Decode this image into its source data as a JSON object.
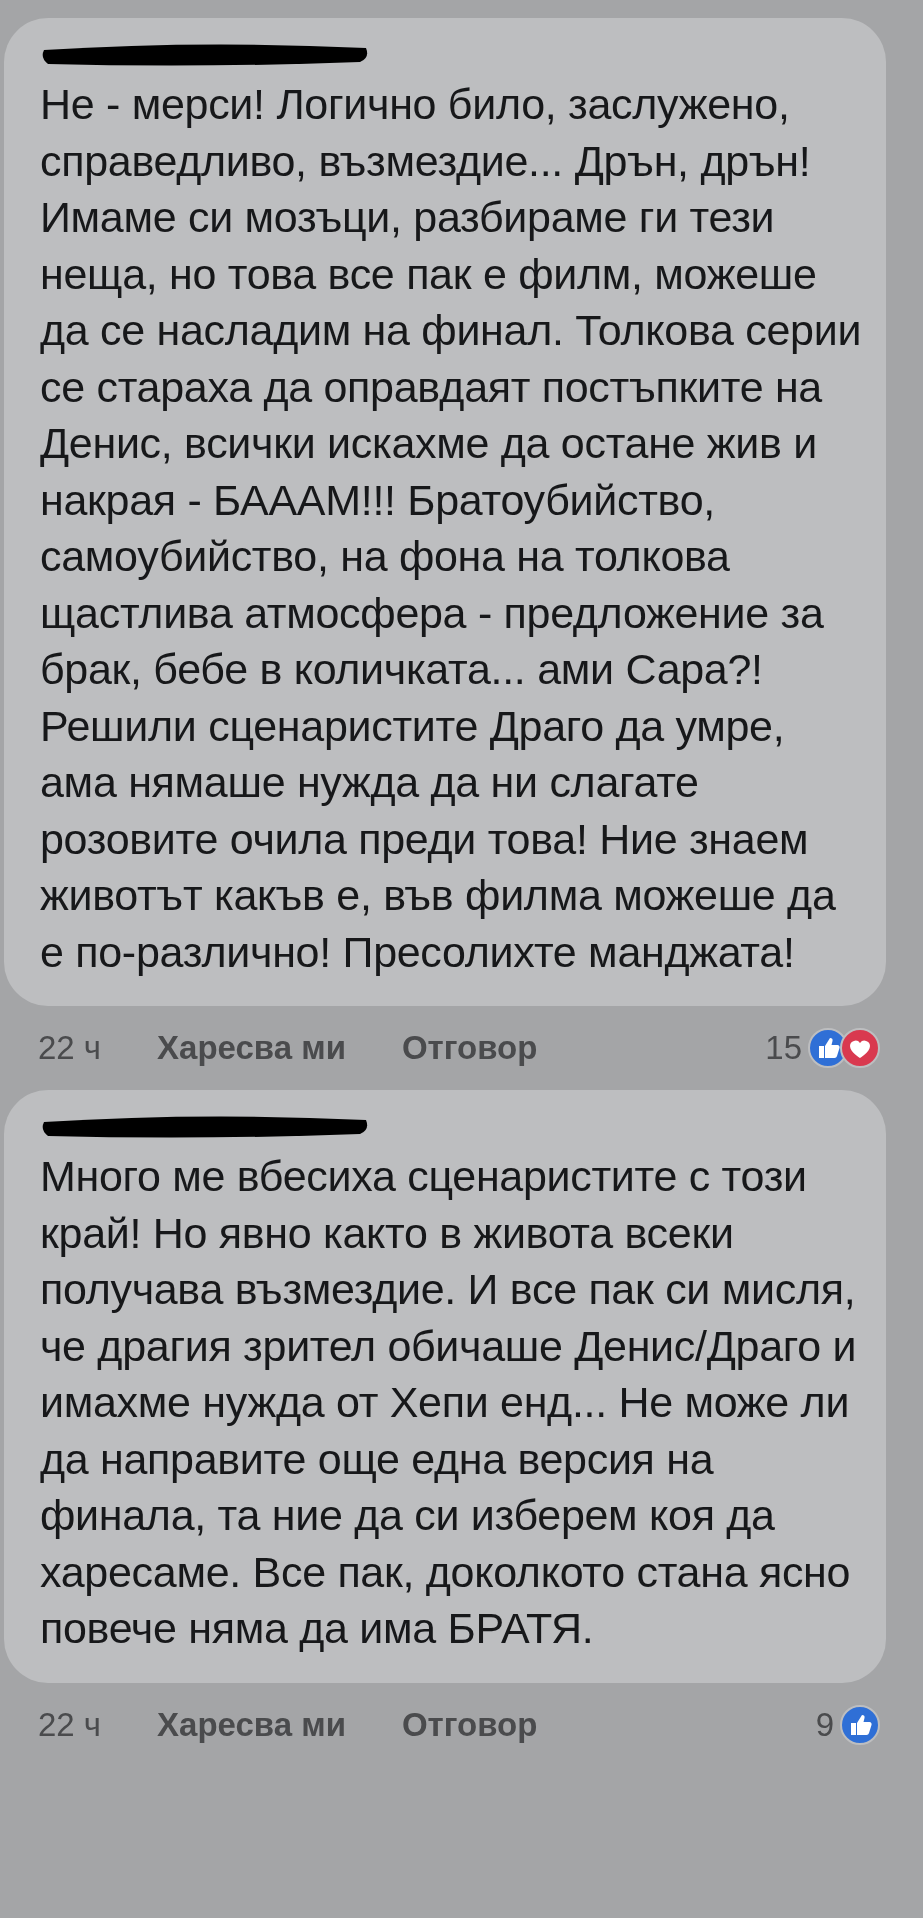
{
  "comments": [
    {
      "author_redacted": true,
      "paragraphs": [
        "Не - мерси! Логично било, заслужено, справедливо, възмездие... Дрън, дрън! Имаме си мозъци, разбираме ги тези неща, но това все пак е филм, можеше да се насладим на финал. Толкова серии се стараха да оправдаят постъпките на Денис, всички искахме да остане жив и накрая - БАААМ!!! Братоубийство, самоубийство, на фона на толкова щастлива атмосфера - предложение за брак, бебе в количката... ами Сара?!",
        "Решили сценаристите Драго да умре, ама нямаше нужда да ни слагате розовите очила преди това! Ние знаем животът какъв е, във филма можеше да е по-различно! Пресолихте манджата!"
      ],
      "time": "22 ч",
      "like": "Харесва ми",
      "reply": "Отговор",
      "count": "15",
      "reactions": [
        {
          "kind": "like"
        },
        {
          "kind": "love"
        }
      ]
    },
    {
      "author_redacted": true,
      "paragraphs": [
        "Много ме вбесиха сценаристите с този край! Но явно както в живота всеки получава възмездие. И все пак си мисля, че драгия зрител обичаше Денис/Драго и имахме нужда от Хепи енд... Не може ли да направите още една версия на финала, та ние да си изберем коя да харесаме. Все пак, доколкото стана ясно повече няма да има БРАТЯ."
      ],
      "time": "22 ч",
      "like": "Харесва ми",
      "reply": "Отговор",
      "count": "9",
      "reactions": [
        {
          "kind": "like"
        }
      ]
    }
  ]
}
